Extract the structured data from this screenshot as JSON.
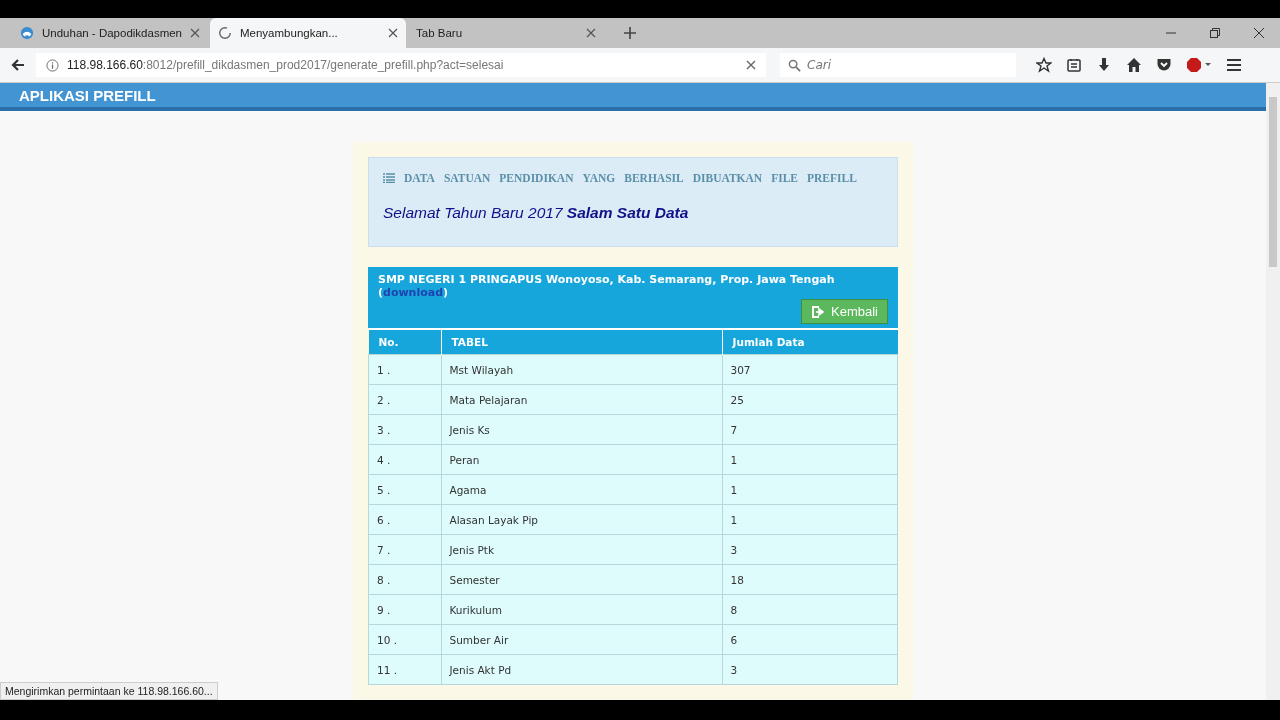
{
  "browser": {
    "tabs": [
      {
        "title": "Unduhan - Dapodikdasmen",
        "kind": "site",
        "selected": false
      },
      {
        "title": "Menyambungkan...",
        "kind": "loading",
        "selected": true
      },
      {
        "title": "Tab Baru",
        "kind": "blank",
        "selected": false
      }
    ],
    "url": {
      "host": "118.98.166.60",
      "rest": ":8012/prefill_dikdasmen_prod2017/generate_prefill.php?act=selesai"
    },
    "search": {
      "placeholder": "Cari"
    },
    "status_text": "Mengirimkan permintaan ke 118.98.166.60..."
  },
  "header": {
    "title": "APLIKASI PREFILL"
  },
  "notice": {
    "heading": [
      "DATA",
      "SATUAN",
      "PENDIDIKAN",
      "YANG",
      "BERHASIL",
      "DIBUATKAN",
      "FILE",
      "PREFILL"
    ],
    "greeting": "Selamat Tahun Baru 2017",
    "greeting_bold": "Salam Satu Data"
  },
  "school": {
    "name": "SMP NEGERI 1 PRINGAPUS Wonoyoso, Kab. Semarang, Prop. Jawa Tengah",
    "paren_open": "(",
    "link": "download",
    "paren_close": ")",
    "back_button": "Kembali"
  },
  "table": {
    "columns": [
      "No.",
      "TABEL",
      "Jumlah Data"
    ],
    "rows": [
      [
        "1 .",
        "Mst Wilayah",
        "307"
      ],
      [
        "2 .",
        "Mata Pelajaran",
        "25"
      ],
      [
        "3 .",
        "Jenis Ks",
        "7"
      ],
      [
        "4 .",
        "Peran",
        "1"
      ],
      [
        "5 .",
        "Agama",
        "1"
      ],
      [
        "6 .",
        "Alasan Layak Pip",
        "1"
      ],
      [
        "7 .",
        "Jenis Ptk",
        "3"
      ],
      [
        "8 .",
        "Semester",
        "18"
      ],
      [
        "9 .",
        "Kurikulum",
        "8"
      ],
      [
        "10 .",
        "Sumber Air",
        "6"
      ],
      [
        "11 .",
        "Jenis Akt Pd",
        "3"
      ]
    ]
  }
}
